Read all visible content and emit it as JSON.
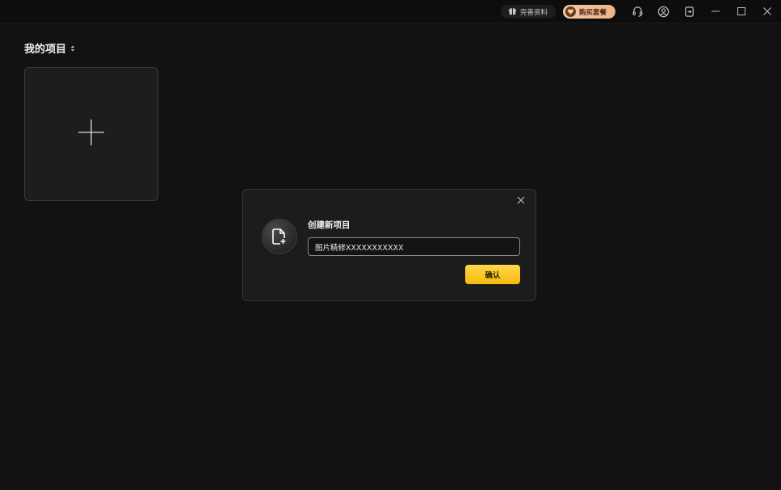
{
  "titlebar": {
    "profile_label": "完善资料",
    "buy_label": "购买套餐",
    "icons": [
      "gift-icon",
      "heart-badge-icon",
      "headset-icon",
      "user-icon",
      "logout-icon",
      "minimize-icon",
      "maximize-icon",
      "close-icon"
    ]
  },
  "main": {
    "section_title": "我的项目"
  },
  "dialog": {
    "title": "创建新项目",
    "input_value": "图片精修XXXXXXXXXXX",
    "confirm_label": "确认"
  },
  "colors": {
    "background": "#121212",
    "accent": "#f5b90c",
    "buy_button": "#eab48a"
  }
}
